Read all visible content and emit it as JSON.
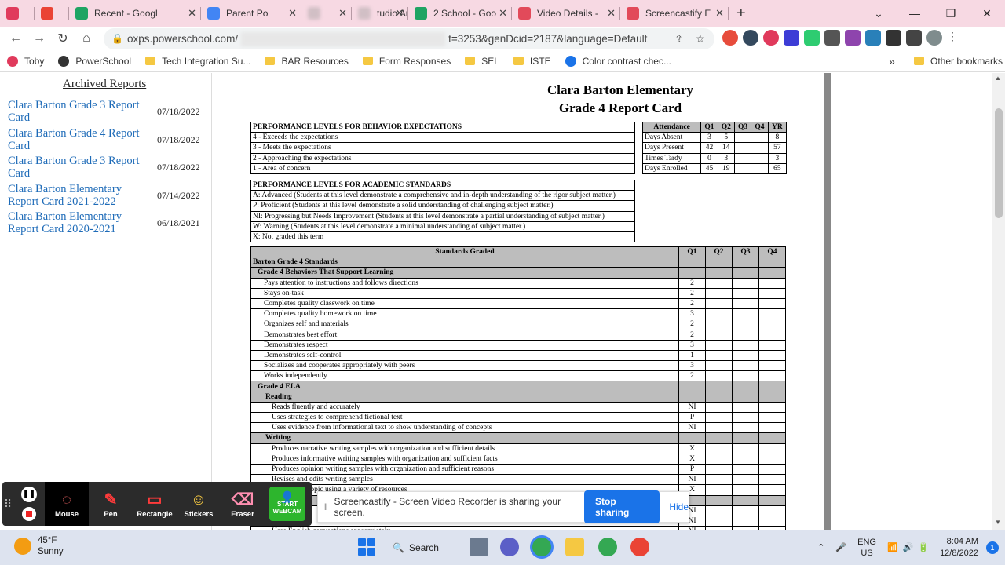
{
  "browser": {
    "tabs": [
      {
        "label": "",
        "icon": "toby-icon",
        "color": "#e03a5c"
      },
      {
        "label": "",
        "icon": "gmail-icon",
        "color": "#ea4335"
      },
      {
        "label": "Recent - Googl",
        "icon": "google-drive-icon",
        "color": "#1fa463"
      },
      {
        "label": "Parent Po",
        "icon": "google-docs-icon",
        "color": "#4285f4"
      },
      {
        "label": "",
        "icon": "blurred-tab-icon",
        "color": "#999999"
      },
      {
        "label": "tudio Ar",
        "icon": "blurred-tab-icon",
        "color": "#999999"
      },
      {
        "label": "2 School - Goo",
        "icon": "google-drive-icon",
        "color": "#1fa463"
      },
      {
        "label": "Video Details -",
        "icon": "screencastify-icon",
        "color": "#e24a5a"
      },
      {
        "label": "Screencastify E",
        "icon": "screencastify-icon",
        "color": "#e24a5a"
      }
    ],
    "url_prefix": "oxps.powerschool.com/",
    "url_suffix": "t=3253&genDcid=2187&language=Default",
    "bookmarks": [
      {
        "label": "Toby",
        "icon": "toby-icon",
        "color": "#e03a5c"
      },
      {
        "label": "PowerSchool",
        "icon": "powerschool-icon",
        "color": "#333333"
      },
      {
        "label": "Tech Integration Su...",
        "icon": "folder-icon",
        "color": "#f5c842"
      },
      {
        "label": "BAR Resources",
        "icon": "folder-icon",
        "color": "#f5c842"
      },
      {
        "label": "Form Responses",
        "icon": "folder-icon",
        "color": "#f5c842"
      },
      {
        "label": "SEL",
        "icon": "folder-icon",
        "color": "#f5c842"
      },
      {
        "label": "ISTE",
        "icon": "folder-icon",
        "color": "#f5c842"
      },
      {
        "label": "Color contrast chec...",
        "icon": "contrast-checker-icon",
        "color": "#1a73e8"
      }
    ],
    "other_bookmarks": "Other bookmarks",
    "more_bookmarks": "»"
  },
  "archived": {
    "title": "Archived Reports",
    "reports": [
      {
        "name": "Clara Barton Grade 3 Report Card",
        "date": "07/18/2022"
      },
      {
        "name": "Clara Barton Grade 4 Report Card",
        "date": "07/18/2022"
      },
      {
        "name": "Clara Barton Grade 3 Report Card",
        "date": "07/18/2022"
      },
      {
        "name": "Clara Barton Elementary Report Card 2021-2022",
        "date": "07/14/2022"
      },
      {
        "name": "Clara Barton Elementary Report Card 2020-2021",
        "date": "06/18/2021"
      }
    ]
  },
  "report": {
    "school": "Clara Barton Elementary",
    "title": "Grade 4 Report Card",
    "behavior_levels": {
      "header": "PERFORMANCE LEVELS FOR BEHAVIOR EXPECTATIONS",
      "rows": [
        "4 - Exceeds the expectations",
        "3 - Meets the expectations",
        "2 - Approaching the expectations",
        "1 - Area of concern"
      ]
    },
    "academic_levels": {
      "header": "PERFORMANCE LEVELS FOR ACADEMIC STANDARDS",
      "rows": [
        "A: Advanced (Students at this level demonstrate a comprehensive and in-depth understanding of the rigor subject matter.)",
        "P: Proficient (Students at this level demonstrate a solid understanding of challenging subject matter.)",
        "NI: Progressing but Needs Improvement (Students at this level demonstrate a partial understanding of subject matter.)",
        "W: Warning (Students at this level demonstrate a minimal understanding of subject matter.)",
        "X: Not graded this term"
      ]
    },
    "attendance": {
      "headers": [
        "Attendance",
        "Q1",
        "Q2",
        "Q3",
        "Q4",
        "YR"
      ],
      "rows": [
        [
          "Days Absent",
          "3",
          "5",
          "",
          "",
          "8"
        ],
        [
          "Days Present",
          "42",
          "14",
          "",
          "",
          "57"
        ],
        [
          "Times Tardy",
          "0",
          "3",
          "",
          "",
          "3"
        ],
        [
          "Days Enrolled",
          "45",
          "19",
          "",
          "",
          "65"
        ]
      ]
    },
    "standards": {
      "headers": [
        "Standards Graded",
        "Q1",
        "Q2",
        "Q3",
        "Q4"
      ],
      "rows": [
        {
          "label": "Barton Grade 4 Standards",
          "q1": "",
          "level": 0,
          "group": true
        },
        {
          "label": "Grade 4 Behaviors That Support Learning",
          "q1": "",
          "level": 1,
          "group": true
        },
        {
          "label": "Pays attention to instructions and follows directions",
          "q1": "2",
          "level": 2
        },
        {
          "label": "Stays on-task",
          "q1": "2",
          "level": 2
        },
        {
          "label": "Completes quality classwork on time",
          "q1": "2",
          "level": 2
        },
        {
          "label": "Completes quality homework on time",
          "q1": "3",
          "level": 2
        },
        {
          "label": "Organizes self and materials",
          "q1": "2",
          "level": 2
        },
        {
          "label": "Demonstrates best effort",
          "q1": "2",
          "level": 2
        },
        {
          "label": "Demonstrates respect",
          "q1": "3",
          "level": 2
        },
        {
          "label": "Demonstrates self-control",
          "q1": "1",
          "level": 2
        },
        {
          "label": "Socializes and cooperates appropriately with peers",
          "q1": "3",
          "level": 2
        },
        {
          "label": "Works independently",
          "q1": "2",
          "level": 2
        },
        {
          "label": "Grade 4 ELA",
          "q1": "",
          "level": 1,
          "group": true
        },
        {
          "label": "Reading",
          "q1": "",
          "level": 3,
          "group": true
        },
        {
          "label": "Reads fluently and accurately",
          "q1": "NI",
          "level": 4
        },
        {
          "label": "Uses strategies to comprehend fictional text",
          "q1": "P",
          "level": 4
        },
        {
          "label": "Uses evidence from informational text to show understanding of concepts",
          "q1": "NI",
          "level": 4
        },
        {
          "label": "Writing",
          "q1": "",
          "level": 3,
          "group": true
        },
        {
          "label": "Produces narrative writing samples with organization and sufficient details",
          "q1": "X",
          "level": 4
        },
        {
          "label": "Produces informative writing samples with organization and sufficient facts",
          "q1": "X",
          "level": 4
        },
        {
          "label": "Produces opinion writing samples with organization and sufficient reasons",
          "q1": "P",
          "level": 4
        },
        {
          "label": "Revises and edits writing samples",
          "q1": "NI",
          "level": 4
        },
        {
          "label": "on a certain topic using a variety of resources",
          "q1": "X",
          "level": 4
        },
        {
          "label": "",
          "q1": "",
          "level": 3,
          "group": true
        },
        {
          "label": "",
          "q1": "NI",
          "level": 4
        },
        {
          "label": "",
          "q1": "NI",
          "level": 4
        },
        {
          "label": "Uses English conventions appropriately",
          "q1": "NI",
          "level": 4
        }
      ]
    }
  },
  "screencastify_toolbar": {
    "tools": [
      {
        "label": "Mouse",
        "icon": "mouse-cursor-icon"
      },
      {
        "label": "Pen",
        "icon": "pen-icon"
      },
      {
        "label": "Rectangle",
        "icon": "rectangle-icon"
      },
      {
        "label": "Stickers",
        "icon": "sticker-icon"
      },
      {
        "label": "Eraser",
        "icon": "eraser-icon"
      }
    ],
    "webcam_label": "START WEBCAM"
  },
  "share_bar": {
    "message": "Screencastify - Screen Video Recorder is sharing your screen.",
    "stop_label": "Stop sharing",
    "hide_label": "Hide"
  },
  "taskbar": {
    "temperature": "45°F",
    "weather": "Sunny",
    "search_label": "Search",
    "language": "ENG",
    "region": "US",
    "time": "8:04 AM",
    "date": "12/8/2022",
    "notification_count": "1"
  }
}
